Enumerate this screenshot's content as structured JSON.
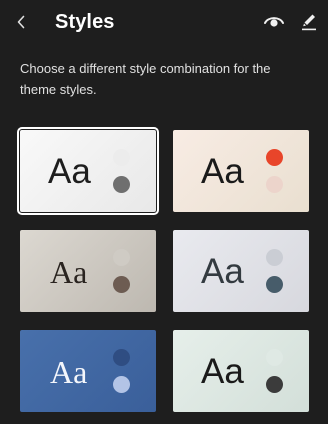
{
  "header": {
    "title": "Styles"
  },
  "description": "Choose a different style combination for the theme styles.",
  "variations": [
    {
      "sample": "Aa",
      "font": "sans",
      "bg": "linear-gradient(135deg, #f9f9f9 0%, #e8e8e8 100%)",
      "text_color": "#1e1e1e",
      "dot_primary": "#ececec",
      "dot_secondary": "#6f6f6f",
      "selected": true
    },
    {
      "sample": "Aa",
      "font": "sans",
      "bg": "linear-gradient(135deg, #f8ece4 0%, #e9dfd0 100%)",
      "text_color": "#1a1a1a",
      "dot_primary": "#e8452a",
      "dot_secondary": "#ecd4cb",
      "selected": false
    },
    {
      "sample": "Aa",
      "font": "serif",
      "bg": "linear-gradient(135deg, #dcd8d1 0%, #bdb8b0 100%)",
      "text_color": "#2a2420",
      "dot_primary": "#cfcbc4",
      "dot_secondary": "#6d5c52",
      "selected": false
    },
    {
      "sample": "Aa",
      "font": "sans",
      "bg": "linear-gradient(135deg, #e9eaef 0%, #d7d8de 100%)",
      "text_color": "#333a40",
      "dot_primary": "#cacdd4",
      "dot_secondary": "#475c6a",
      "selected": false
    },
    {
      "sample": "Aa",
      "font": "serif",
      "bg": "linear-gradient(135deg, #4870ab 0%, #3a5f9a 100%)",
      "text_color": "#f4f6fb",
      "dot_primary": "#2f4d82",
      "dot_secondary": "#b3c4e6",
      "selected": false
    },
    {
      "sample": "Aa",
      "font": "sans",
      "bg": "linear-gradient(135deg, #e6efea 0%, #d3dfd9 100%)",
      "text_color": "#1a1a1a",
      "dot_primary": "#dfe9e4",
      "dot_secondary": "#3b3b3b",
      "selected": false
    }
  ]
}
